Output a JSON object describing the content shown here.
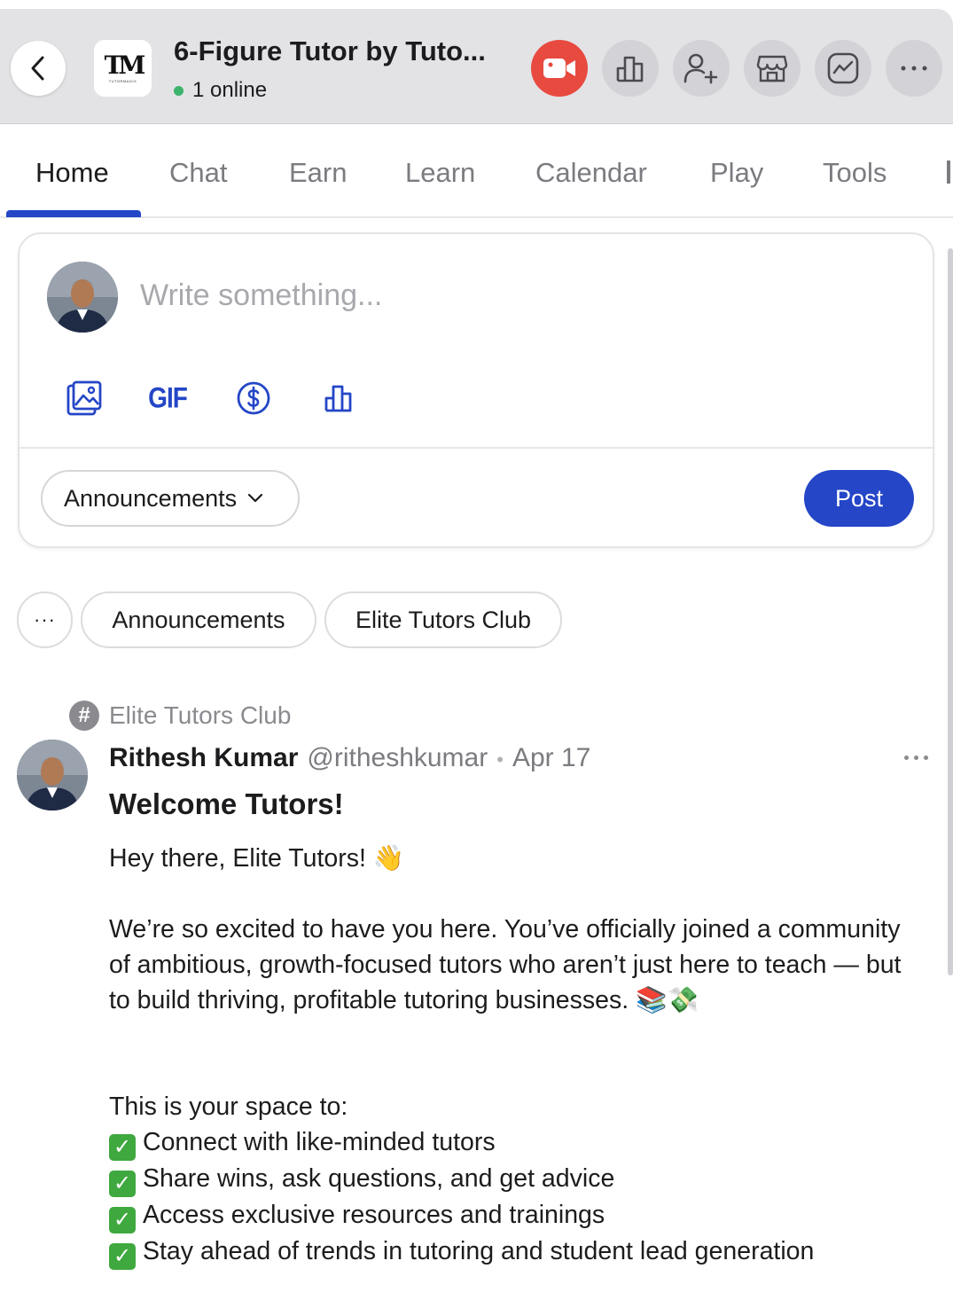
{
  "header": {
    "title": "6-Figure Tutor by Tuto...",
    "online_text": "1 online",
    "logo_text": "TM",
    "logo_subtext": "TUTORMAGIX"
  },
  "tabs": [
    {
      "label": "Home",
      "active": true
    },
    {
      "label": "Chat"
    },
    {
      "label": "Earn"
    },
    {
      "label": "Learn"
    },
    {
      "label": "Calendar"
    },
    {
      "label": "Play"
    },
    {
      "label": "Tools"
    }
  ],
  "composer": {
    "placeholder": "Write something...",
    "gif_label": "GIF",
    "channel_select": "Announcements",
    "post_label": "Post"
  },
  "filters": {
    "more": "···",
    "chips": [
      "Announcements",
      "Elite Tutors Club"
    ]
  },
  "post": {
    "channel": "Elite Tutors Club",
    "author": "Rithesh Kumar",
    "handle": "@ritheshkumar",
    "separator": "•",
    "date": "Apr 17",
    "title": "Welcome Tutors!",
    "greeting": "Hey there, Elite Tutors! 👋",
    "paragraph": "We’re so excited to have you here. You’ve officially joined a community of ambitious, growth-focused tutors who aren’t just here to teach — but to build thriving, profitable tutoring businesses. 📚💸",
    "list_intro": "This is your space to:",
    "check_glyph": "✓",
    "list_items": [
      "Connect with like-minded tutors",
      "Share wins, ask questions, and get advice",
      "Access exclusive resources and trainings",
      "Stay ahead of trends in tutoring and student lead generation"
    ]
  },
  "colors": {
    "accent": "#2446c7",
    "video": "#e84a3f",
    "online": "#3db36c",
    "check": "#3fa83f"
  }
}
